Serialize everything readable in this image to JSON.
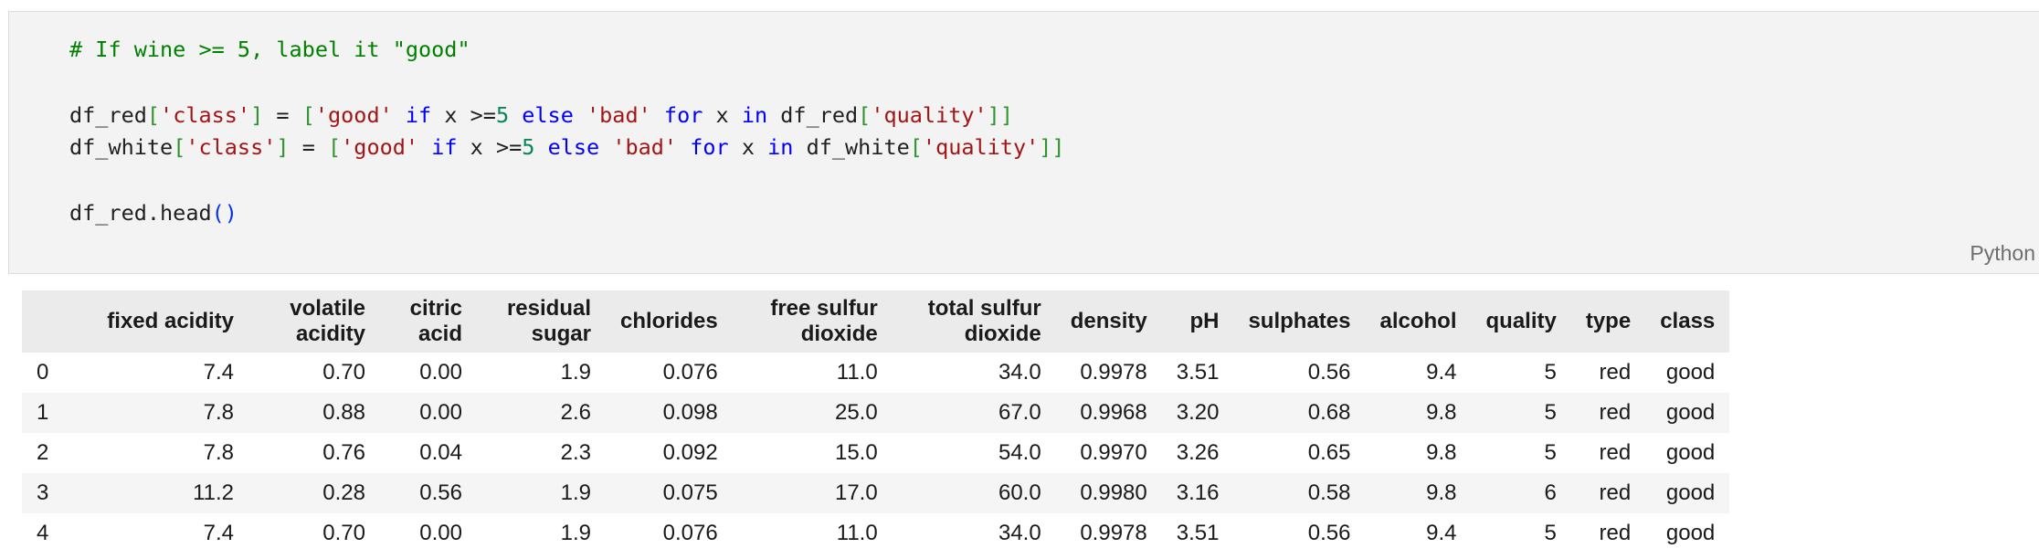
{
  "code_cell": {
    "lines": [
      [
        {
          "t": "# If wine >= 5, label it \"good\"",
          "c": "comment"
        }
      ],
      [],
      [
        {
          "t": "df_red",
          "c": "plain"
        },
        {
          "t": "[",
          "c": "bracket"
        },
        {
          "t": "'class'",
          "c": "string"
        },
        {
          "t": "]",
          "c": "bracket"
        },
        {
          "t": " = ",
          "c": "plain"
        },
        {
          "t": "[",
          "c": "bracket"
        },
        {
          "t": "'good'",
          "c": "string"
        },
        {
          "t": " ",
          "c": "plain"
        },
        {
          "t": "if",
          "c": "keyword"
        },
        {
          "t": " x >=",
          "c": "plain"
        },
        {
          "t": "5",
          "c": "number"
        },
        {
          "t": " ",
          "c": "plain"
        },
        {
          "t": "else",
          "c": "keyword"
        },
        {
          "t": " ",
          "c": "plain"
        },
        {
          "t": "'bad'",
          "c": "string"
        },
        {
          "t": " ",
          "c": "plain"
        },
        {
          "t": "for",
          "c": "keyword"
        },
        {
          "t": " x ",
          "c": "plain"
        },
        {
          "t": "in",
          "c": "keyword"
        },
        {
          "t": " df_red",
          "c": "plain"
        },
        {
          "t": "[",
          "c": "bracket"
        },
        {
          "t": "'quality'",
          "c": "string"
        },
        {
          "t": "]]",
          "c": "bracket"
        }
      ],
      [
        {
          "t": "df_white",
          "c": "plain"
        },
        {
          "t": "[",
          "c": "bracket"
        },
        {
          "t": "'class'",
          "c": "string"
        },
        {
          "t": "]",
          "c": "bracket"
        },
        {
          "t": " = ",
          "c": "plain"
        },
        {
          "t": "[",
          "c": "bracket"
        },
        {
          "t": "'good'",
          "c": "string"
        },
        {
          "t": " ",
          "c": "plain"
        },
        {
          "t": "if",
          "c": "keyword"
        },
        {
          "t": " x >=",
          "c": "plain"
        },
        {
          "t": "5",
          "c": "number"
        },
        {
          "t": " ",
          "c": "plain"
        },
        {
          "t": "else",
          "c": "keyword"
        },
        {
          "t": " ",
          "c": "plain"
        },
        {
          "t": "'bad'",
          "c": "string"
        },
        {
          "t": " ",
          "c": "plain"
        },
        {
          "t": "for",
          "c": "keyword"
        },
        {
          "t": " x ",
          "c": "plain"
        },
        {
          "t": "in",
          "c": "keyword"
        },
        {
          "t": " df_white",
          "c": "plain"
        },
        {
          "t": "[",
          "c": "bracket"
        },
        {
          "t": "'quality'",
          "c": "string"
        },
        {
          "t": "]]",
          "c": "bracket"
        }
      ],
      [],
      [
        {
          "t": "df_red.head",
          "c": "plain"
        },
        {
          "t": "()",
          "c": "bracket2"
        }
      ]
    ],
    "language_label": "Python"
  },
  "colors": {
    "comment": "#008000",
    "string": "#a31515",
    "keyword": "#0000ff",
    "number": "#098658",
    "bracket": "#319331",
    "bracket2": "#0431fa",
    "cell_background": "#f3f3f3",
    "header_background": "#ebebeb",
    "stripe_background": "#f5f5f5"
  },
  "table": {
    "columns": [
      "",
      "fixed acidity",
      "volatile acidity",
      "citric acid",
      "residual sugar",
      "chlorides",
      "free sulfur dioxide",
      "total sulfur dioxide",
      "density",
      "pH",
      "sulphates",
      "alcohol",
      "quality",
      "type",
      "class"
    ],
    "rows": [
      [
        "0",
        "7.4",
        "0.70",
        "0.00",
        "1.9",
        "0.076",
        "11.0",
        "34.0",
        "0.9978",
        "3.51",
        "0.56",
        "9.4",
        "5",
        "red",
        "good"
      ],
      [
        "1",
        "7.8",
        "0.88",
        "0.00",
        "2.6",
        "0.098",
        "25.0",
        "67.0",
        "0.9968",
        "3.20",
        "0.68",
        "9.8",
        "5",
        "red",
        "good"
      ],
      [
        "2",
        "7.8",
        "0.76",
        "0.04",
        "2.3",
        "0.092",
        "15.0",
        "54.0",
        "0.9970",
        "3.26",
        "0.65",
        "9.8",
        "5",
        "red",
        "good"
      ],
      [
        "3",
        "11.2",
        "0.28",
        "0.56",
        "1.9",
        "0.075",
        "17.0",
        "60.0",
        "0.9980",
        "3.16",
        "0.58",
        "9.8",
        "6",
        "red",
        "good"
      ],
      [
        "4",
        "7.4",
        "0.70",
        "0.00",
        "1.9",
        "0.076",
        "11.0",
        "34.0",
        "0.9978",
        "3.51",
        "0.56",
        "9.4",
        "5",
        "red",
        "good"
      ]
    ]
  }
}
